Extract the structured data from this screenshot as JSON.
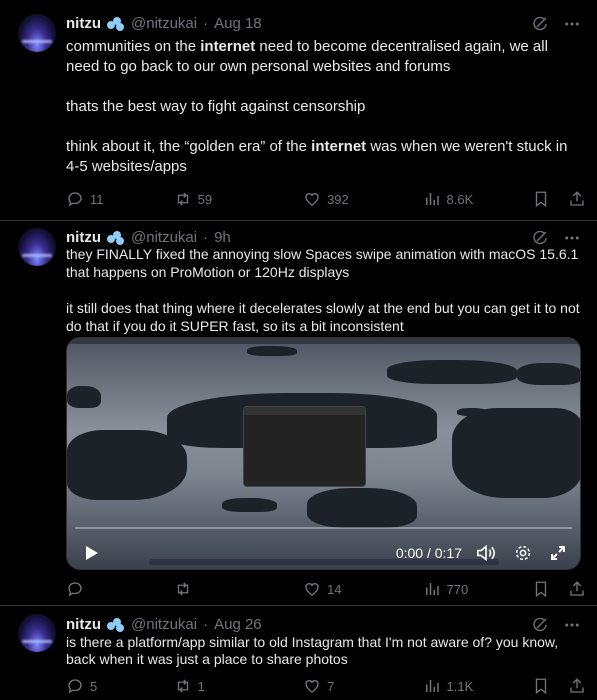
{
  "tweets": [
    {
      "author": "nitzu",
      "handle": "@nitzukai",
      "time": "Aug 18",
      "separator": "·",
      "paragraphs": [
        [
          "communities on the ",
          "internet",
          " need to become decentralised again, we all need to go back to our own personal websites and forums"
        ],
        [
          "thats the best way to fight against censorship"
        ],
        [
          "think about it, the “golden era” of the ",
          "internet",
          " was when we weren't stuck in 4-5 websites/apps"
        ]
      ],
      "stats": {
        "replies": "11",
        "reposts": "59",
        "likes": "392",
        "views": "8.6K"
      }
    },
    {
      "author": "nitzu",
      "handle": "@nitzukai",
      "time": "9h",
      "separator": "·",
      "paragraphs": [
        [
          "they FINALLY fixed the annoying slow Spaces swipe animation with macOS 15.6.1 that happens on ProMotion or 120Hz displays"
        ],
        [
          "it still does that thing where it decelerates slowly at the end but you can get it to not do that if you do it SUPER fast, so its a bit inconsistent"
        ]
      ],
      "video": {
        "time_display": "0:00 / 0:17",
        "progress": 0.0
      },
      "stats": {
        "replies": "",
        "reposts": "",
        "likes": "14",
        "views": "770"
      }
    },
    {
      "author": "nitzu",
      "handle": "@nitzukai",
      "time": "Aug 26",
      "separator": "·",
      "paragraphs": [
        [
          "is there a platform/app similar to old Instagram that I'm not aware of? you know, back when it was just a place to share photos"
        ]
      ],
      "stats": {
        "replies": "5",
        "reposts": "1",
        "likes": "7",
        "views": "1.1K"
      }
    }
  ],
  "icons": {
    "grok": "grok-icon",
    "more": "more-icon",
    "reply": "reply-icon",
    "repost": "repost-icon",
    "like": "like-icon",
    "views": "views-icon",
    "bookmark": "bookmark-icon",
    "share": "share-icon",
    "play": "play-icon",
    "volume": "volume-icon",
    "settings": "settings-icon",
    "fullscreen": "fullscreen-icon"
  },
  "colors": {
    "background": "#000000",
    "text": "#e7e9ea",
    "muted": "#71767b",
    "divider": "#2f3336",
    "verified": "#8ecdf8"
  }
}
